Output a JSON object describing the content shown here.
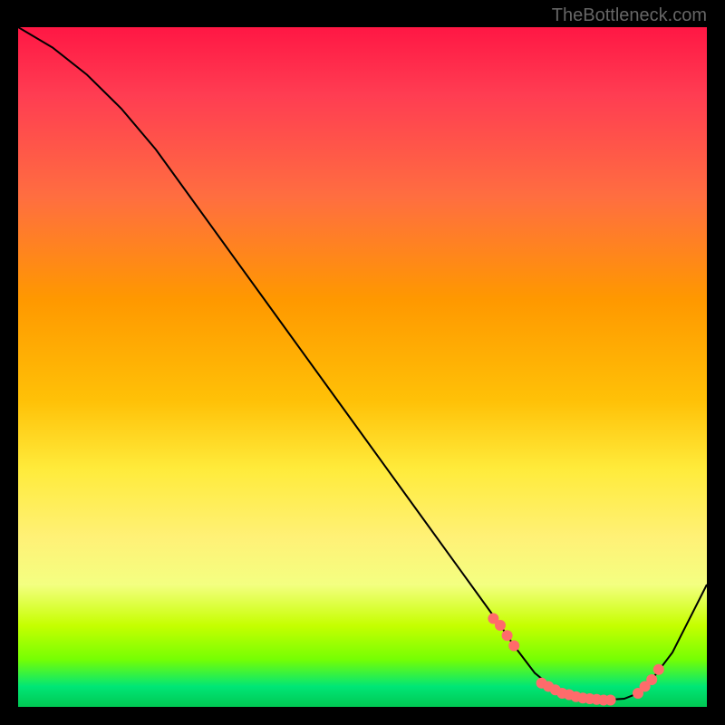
{
  "watermark": "TheBottleneck.com",
  "chart_data": {
    "type": "line",
    "title": "",
    "xlabel": "",
    "ylabel": "",
    "xlim": [
      0,
      100
    ],
    "ylim": [
      0,
      100
    ],
    "curve": {
      "x": [
        0,
        5,
        10,
        15,
        20,
        25,
        30,
        35,
        40,
        45,
        50,
        55,
        60,
        65,
        70,
        72,
        75,
        78,
        80,
        82,
        85,
        88,
        90,
        92,
        95,
        100
      ],
      "y": [
        100,
        97,
        93,
        88,
        82,
        75,
        68,
        61,
        54,
        47,
        40,
        33,
        26,
        19,
        12,
        9,
        5,
        2.5,
        1.5,
        1,
        1,
        1.2,
        2,
        4,
        8,
        18
      ]
    },
    "highlighted_points": {
      "x": [
        69,
        70,
        71,
        72,
        76,
        77,
        78,
        79,
        80,
        81,
        82,
        83,
        84,
        85,
        86,
        90,
        91,
        92,
        93
      ],
      "y": [
        13,
        12,
        10.5,
        9,
        3.5,
        3,
        2.5,
        2,
        1.8,
        1.5,
        1.3,
        1.2,
        1.1,
        1,
        1,
        2,
        3,
        4,
        5.5
      ]
    }
  }
}
